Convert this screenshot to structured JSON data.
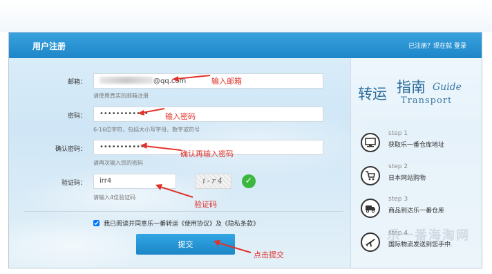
{
  "header": {
    "title": "用户注册",
    "login_prompt": "已注册？现在就",
    "login_link": "登录"
  },
  "form": {
    "email": {
      "label": "邮箱：",
      "value_suffix": "@qq.com",
      "hint": "请使用真实的邮箱注册",
      "annotation": "输入邮箱"
    },
    "password": {
      "label": "密码：",
      "value": "••••••••••••",
      "hint": "6-16位字符，包括大小写字母、数字或符号",
      "annotation": "输入密码"
    },
    "confirm": {
      "label": "确认密码：",
      "value": "••••••••••••",
      "hint": "请再次输入您的密码",
      "annotation": "确认再输入密码"
    },
    "captcha": {
      "label": "验证码：",
      "value": "irr4",
      "image_text": "i-r4",
      "hint": "请输入4位验证码",
      "annotation": "验证码"
    },
    "agree_text": "我已阅读并同意乐一番转运《使用协议》及《隐私条款》",
    "submit_label": "提交",
    "submit_annotation": "点击提交"
  },
  "guide": {
    "title_cn_1": "转运",
    "title_cn_2": "指南",
    "title_en_1": "Guide",
    "title_en_2": "Transport",
    "steps": [
      {
        "num": "step 1",
        "text": "获取乐一番仓库地址",
        "icon": "computer-icon"
      },
      {
        "num": "step 2",
        "text": "日本网站购物",
        "icon": "shopping-cart-icon"
      },
      {
        "num": "step 3",
        "text": "商品到达乐一番仓库",
        "icon": "truck-icon"
      },
      {
        "num": "step 4",
        "text": "国际物流发送到您手中",
        "icon": "airplane-icon"
      }
    ]
  },
  "watermark": {
    "text": "乐一番海淘网",
    "url_text": "www.55haitao.com"
  },
  "colors": {
    "header": "#1d86c9",
    "annotation": "#e0332b",
    "check": "#3bb83d",
    "submit": "#1b86c7"
  }
}
